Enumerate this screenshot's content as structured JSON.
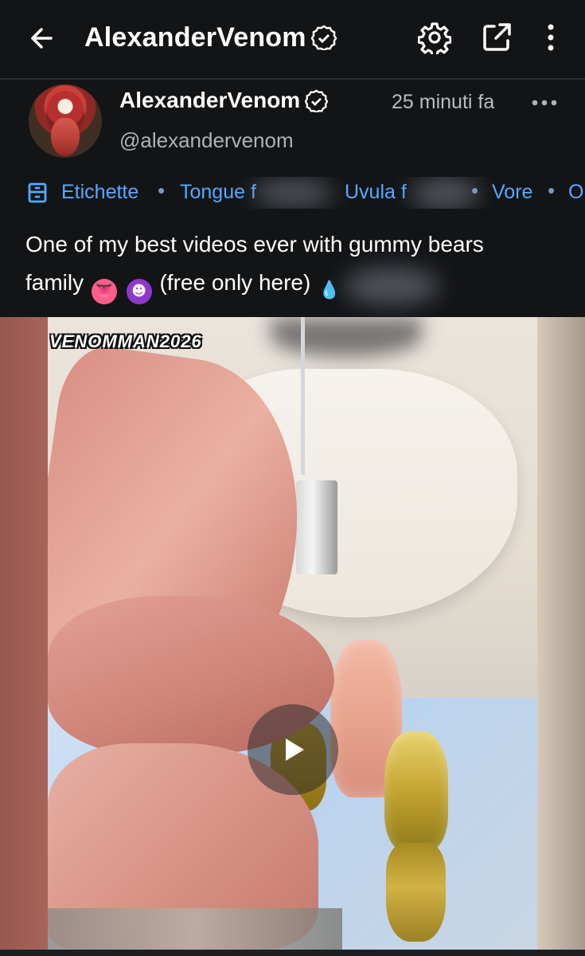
{
  "header": {
    "title": "AlexanderVenom",
    "back_icon": "arrow-left-icon",
    "settings_icon": "gear-icon",
    "share_icon": "share-icon",
    "more_icon": "more-vertical-icon",
    "verified_icon": "verified-badge-icon"
  },
  "post": {
    "author": "AlexanderVenom",
    "handle": "@alexandervenom",
    "time": "25 minuti fa",
    "more_icon": "more-horizontal-icon",
    "tags_label": "Etichette",
    "tags": [
      "Tongue f",
      "Uvula f",
      "Vore",
      "O"
    ],
    "caption_line1": "One of my best videos ever with gummy bears",
    "caption_line2_prefix": "family",
    "caption_line2_suffix": "(free only here)",
    "emojis": [
      "tongue-emoji",
      "devil-emoji",
      "droplet-emoji"
    ]
  },
  "media": {
    "watermark": "VENOMMAN2026",
    "play_icon": "play-icon"
  },
  "colors": {
    "background": "#131416",
    "accent_blue": "#56a9ff",
    "muted_text": "#aeb2b8"
  }
}
